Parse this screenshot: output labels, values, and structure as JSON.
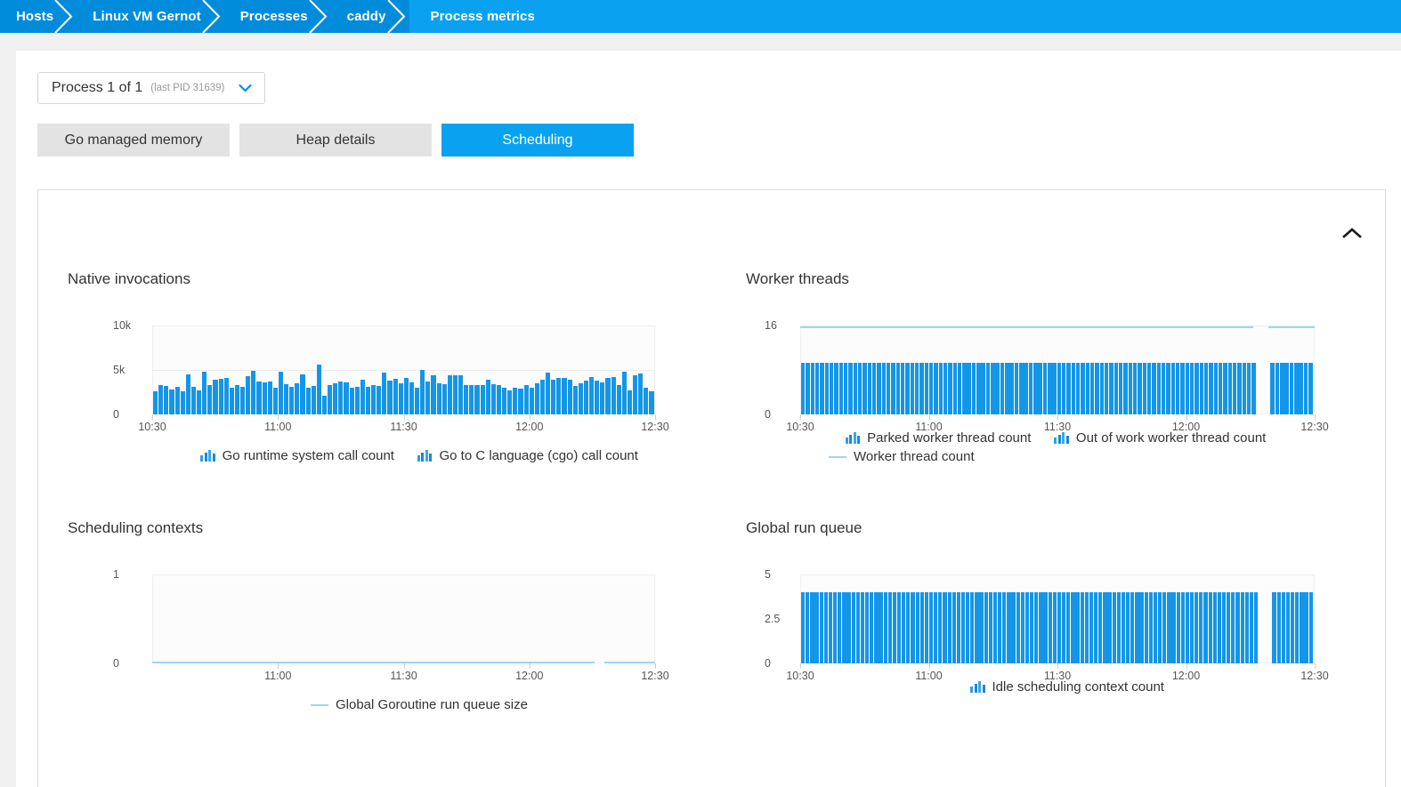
{
  "breadcrumb": {
    "items": [
      {
        "label": "Hosts",
        "active": false
      },
      {
        "label": "Linux VM Gernot",
        "active": false
      },
      {
        "label": "Processes",
        "active": false
      },
      {
        "label": "caddy",
        "active": false
      },
      {
        "label": "Process metrics",
        "active": true
      }
    ]
  },
  "process_selector": {
    "title": "Process 1 of 1",
    "subtitle": "(last PID 31639)",
    "chevron_icon": "chevron-down-icon"
  },
  "tabs": [
    {
      "label": "Go managed memory",
      "selected": false
    },
    {
      "label": "Heap details",
      "selected": false
    },
    {
      "label": "Scheduling",
      "selected": true
    }
  ],
  "panel": {
    "collapse_icon": "chevron-up-icon"
  },
  "colors": {
    "breadcrumb": "#008cdb",
    "breadcrumb_active": "#0aa2f0",
    "accent": "#0aa2f0",
    "bar": "#1496e8",
    "line": "#9ad6f5",
    "tab_inactive": "#e3e3e3",
    "page_bg": "#f0f0f0"
  },
  "chart_data": [
    {
      "id": "native-invocations",
      "type": "bar",
      "title": "Native invocations",
      "xlabel": "",
      "ylabel": "",
      "ylim": [
        0,
        10000
      ],
      "yticks": [
        0,
        5000,
        10000
      ],
      "ytick_labels": [
        "0",
        "5k",
        "10k"
      ],
      "grid": true,
      "x_tick_labels": [
        "10:30",
        "11:00",
        "11:30",
        "12:00",
        "12:30"
      ],
      "x_tick_positions": [
        0.0,
        0.25,
        0.5,
        0.75,
        1.0
      ],
      "legend": [
        {
          "label": "Go runtime system call count",
          "icon": "bar-series-icon",
          "color": "#1496e8"
        },
        {
          "label": "Go to C language (cgo) call count",
          "icon": "bar-series-icon",
          "color": "#1496e8"
        }
      ],
      "series": [
        {
          "name": "Go runtime system call count",
          "values": [
            2600,
            3300,
            3250,
            2800,
            3100,
            2600,
            4550,
            3150,
            2700,
            4800,
            3350,
            3900,
            4050,
            4100,
            3050,
            3300,
            3150,
            4350,
            4950,
            3750,
            3600,
            3750,
            3000,
            4850,
            3450,
            3100,
            3500,
            4550,
            3050,
            3200,
            5650,
            2150,
            3350,
            3500,
            3700,
            3600,
            3000,
            3150,
            3900,
            3150,
            3350,
            3250,
            4700,
            3800,
            4000,
            3500,
            4100,
            3650,
            3000,
            5050,
            3750,
            4400,
            3500,
            3400,
            4400,
            4450,
            4400,
            3350,
            3350,
            3300,
            3300,
            3950,
            3400,
            3350,
            3000,
            2700,
            3050,
            2950,
            3350,
            3050,
            3500,
            3950,
            4700,
            3900,
            4150,
            4100,
            3950,
            3200,
            3500,
            3800,
            4200,
            3800,
            3600,
            4100,
            4200,
            3350,
            4800,
            2750,
            4400,
            4650,
            3000,
            2600
          ]
        }
      ]
    },
    {
      "id": "worker-threads",
      "type": "bar",
      "title": "Worker threads",
      "xlabel": "",
      "ylabel": "",
      "ylim": [
        0,
        16
      ],
      "yticks": [
        0,
        16
      ],
      "ytick_labels": [
        "0",
        "16"
      ],
      "grid": false,
      "x_tick_labels": [
        "10:30",
        "11:00",
        "11:30",
        "12:00",
        "12:30"
      ],
      "x_tick_positions": [
        0.0,
        0.25,
        0.5,
        0.75,
        1.0
      ],
      "legend": [
        {
          "label": "Parked worker thread count",
          "icon": "bar-series-icon",
          "color": "#1496e8"
        },
        {
          "label": "Out of work worker thread count",
          "icon": "bar-series-icon",
          "color": "#1c87d8"
        },
        {
          "label": "Worker thread count",
          "icon": "line-series-icon",
          "color": "#9ad6f5"
        }
      ],
      "series": [
        {
          "name": "Parked worker thread count",
          "constant_value": 9.3,
          "note": "uniform bars at ~9 across full range with a short data gap near 12:20"
        },
        {
          "name": "Worker thread count",
          "type": "line",
          "constant_value": 16,
          "note": "flat line at 16 with a short gap near 12:20"
        }
      ]
    },
    {
      "id": "scheduling-contexts",
      "type": "line",
      "title": "Scheduling contexts",
      "xlabel": "",
      "ylabel": "",
      "ylim": [
        0,
        1
      ],
      "yticks": [
        0,
        1
      ],
      "ytick_labels": [
        "0",
        "1"
      ],
      "grid": false,
      "x_tick_labels": [
        "11:00",
        "11:30",
        "12:00",
        "12:30"
      ],
      "x_tick_positions": [
        0.25,
        0.5,
        0.75,
        1.0
      ],
      "legend": [
        {
          "label": "Global Goroutine run queue size",
          "icon": "line-series-icon",
          "color": "#9ad6f5"
        }
      ],
      "series": [
        {
          "name": "Global Goroutine run queue size",
          "constant_value": 0,
          "note": "flat at 0 across entire range with a small break near 12:20"
        }
      ]
    },
    {
      "id": "global-run-queue",
      "type": "bar",
      "title": "Global run queue",
      "xlabel": "",
      "ylabel": "",
      "ylim": [
        0,
        5
      ],
      "yticks": [
        0,
        2.5,
        5
      ],
      "ytick_labels": [
        "0",
        "2.5",
        "5"
      ],
      "grid": false,
      "x_tick_labels": [
        "10:30",
        "11:00",
        "11:30",
        "12:00",
        "12:30"
      ],
      "x_tick_positions": [
        0.0,
        0.25,
        0.5,
        0.75,
        1.0
      ],
      "legend": [
        {
          "label": "Idle scheduling context count",
          "icon": "bar-series-icon",
          "color": "#1496e8"
        }
      ],
      "series": [
        {
          "name": "Idle scheduling context count",
          "constant_value": 4,
          "note": "uniform bars at 4 across full range with a short data gap near 12:20"
        }
      ]
    }
  ]
}
